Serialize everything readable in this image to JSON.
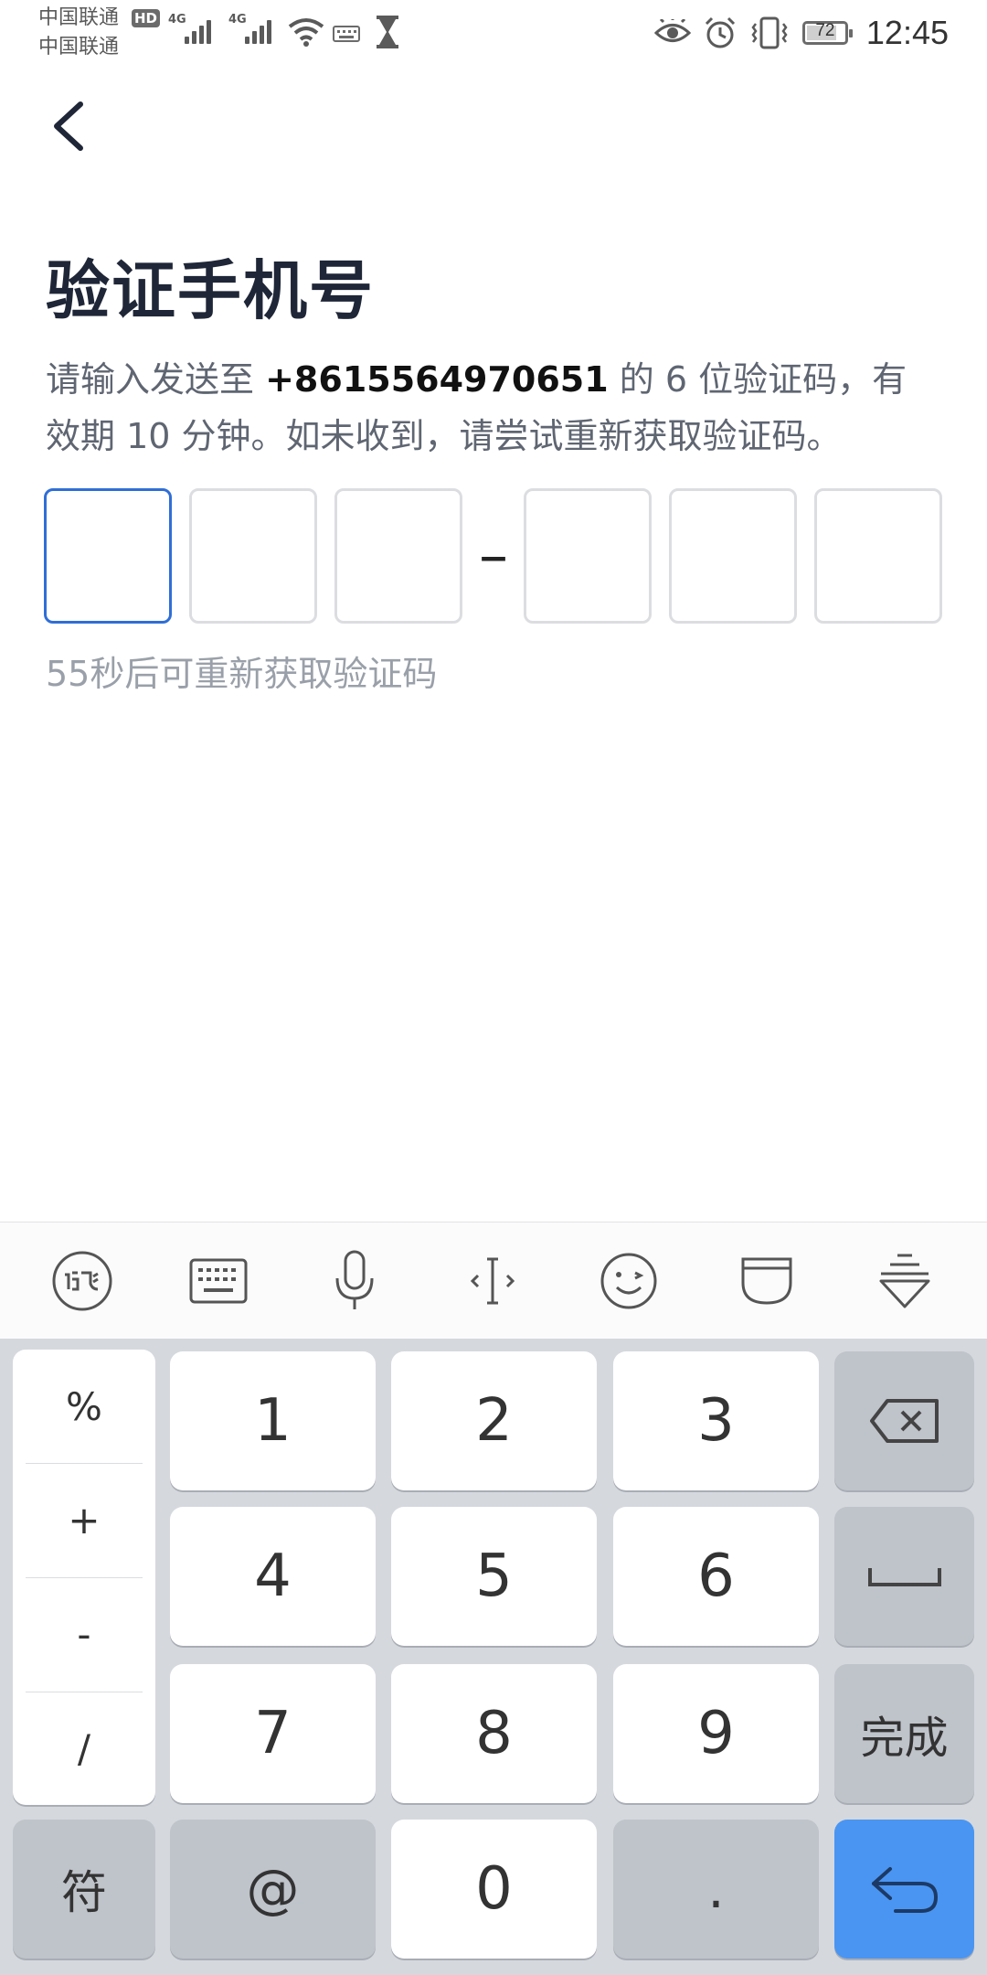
{
  "status_bar": {
    "carrier_1": "中国联通",
    "carrier_2": "中国联通",
    "hd_badge": "HD",
    "network_1": "4G",
    "network_2": "4G",
    "battery": "72",
    "time": "12:45"
  },
  "page": {
    "title": "验证手机号",
    "desc_prefix": "请输入发送至 ",
    "phone": "+8615564970651",
    "desc_suffix": " 的 6 位验证码，有效期 10 分钟。如未收到，请尝试重新获取验证码。",
    "resend": "55秒后可重新获取验证码",
    "code_separator": "–"
  },
  "keyboard": {
    "symbols": [
      "%",
      "+",
      "-",
      "/"
    ],
    "digits": [
      "1",
      "2",
      "3",
      "4",
      "5",
      "6",
      "7",
      "8",
      "9"
    ],
    "done": "完成",
    "fu": "符",
    "at": "@",
    "zero": "0",
    "dot": "."
  },
  "colors": {
    "accent": "#2f6ed6",
    "enter_key": "#4a95f2"
  }
}
